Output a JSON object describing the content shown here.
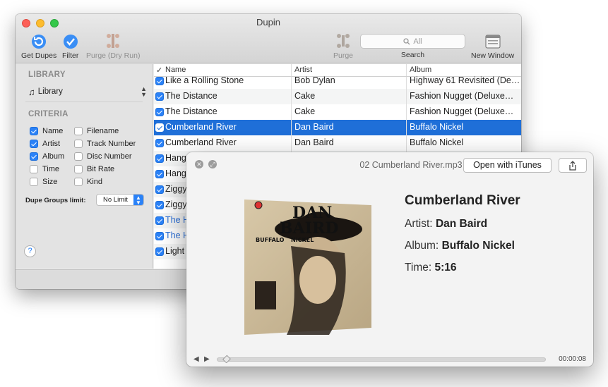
{
  "window": {
    "title": "Dupin"
  },
  "toolbar": {
    "get_dupes": "Get Dupes",
    "filter": "Filter",
    "purge_dry": "Purge (Dry Run)",
    "purge": "Purge",
    "search_placeholder": "All",
    "search_label": "Search",
    "new_window": "New Window"
  },
  "sidebar": {
    "library_header": "LIBRARY",
    "library_value": "Library",
    "criteria_header": "CRITERIA",
    "criteria": [
      {
        "label": "Name",
        "checked": true
      },
      {
        "label": "Filename",
        "checked": false
      },
      {
        "label": "Artist",
        "checked": true
      },
      {
        "label": "Track Number",
        "checked": false
      },
      {
        "label": "Album",
        "checked": true
      },
      {
        "label": "Disc Number",
        "checked": false
      },
      {
        "label": "Time",
        "checked": false
      },
      {
        "label": "Bit Rate",
        "checked": false
      },
      {
        "label": "Size",
        "checked": false
      },
      {
        "label": "Kind",
        "checked": false
      }
    ],
    "limit_label": "Dupe Groups limit:",
    "limit_value": "No Limit",
    "help": "?"
  },
  "table": {
    "columns": {
      "check": "✓",
      "name": "Name",
      "artist": "Artist",
      "album": "Album"
    },
    "rows": [
      {
        "name": "Like a Rolling Stone",
        "artist": "Bob Dylan",
        "album": "Highway 61 Revisited (De…"
      },
      {
        "name": "The Distance",
        "artist": "Cake",
        "album": "Fashion Nugget (Deluxe…"
      },
      {
        "name": "The Distance",
        "artist": "Cake",
        "album": "Fashion Nugget (Deluxe…"
      },
      {
        "name": "Cumberland River",
        "artist": "Dan Baird",
        "album": "Buffalo Nickel"
      },
      {
        "name": "Cumberland River",
        "artist": "Dan Baird",
        "album": "Buffalo Nickel"
      },
      {
        "name": "Hang",
        "artist": "",
        "album": ""
      },
      {
        "name": "Hang",
        "artist": "",
        "album": ""
      },
      {
        "name": "Ziggy",
        "artist": "",
        "album": ""
      },
      {
        "name": "Ziggy",
        "artist": "",
        "album": ""
      },
      {
        "name": "The H",
        "artist": "",
        "album": ""
      },
      {
        "name": "The H",
        "artist": "",
        "album": ""
      },
      {
        "name": "Light",
        "artist": "",
        "album": ""
      }
    ]
  },
  "quicklook": {
    "filename": "02 Cumberland River.mp3",
    "open_button": "Open with iTunes",
    "art_lines": [
      "DAN",
      "BAIRD",
      "BUFFALO",
      "NICKEL"
    ],
    "track_title": "Cumberland River",
    "artist_label": "Artist:",
    "artist_value": "Dan Baird",
    "album_label": "Album:",
    "album_value": "Buffalo Nickel",
    "time_label": "Time:",
    "time_value": "5:16",
    "elapsed": "00:00:08"
  },
  "colors": {
    "selection": "#1f6fd8",
    "accent": "#2b82f7"
  }
}
